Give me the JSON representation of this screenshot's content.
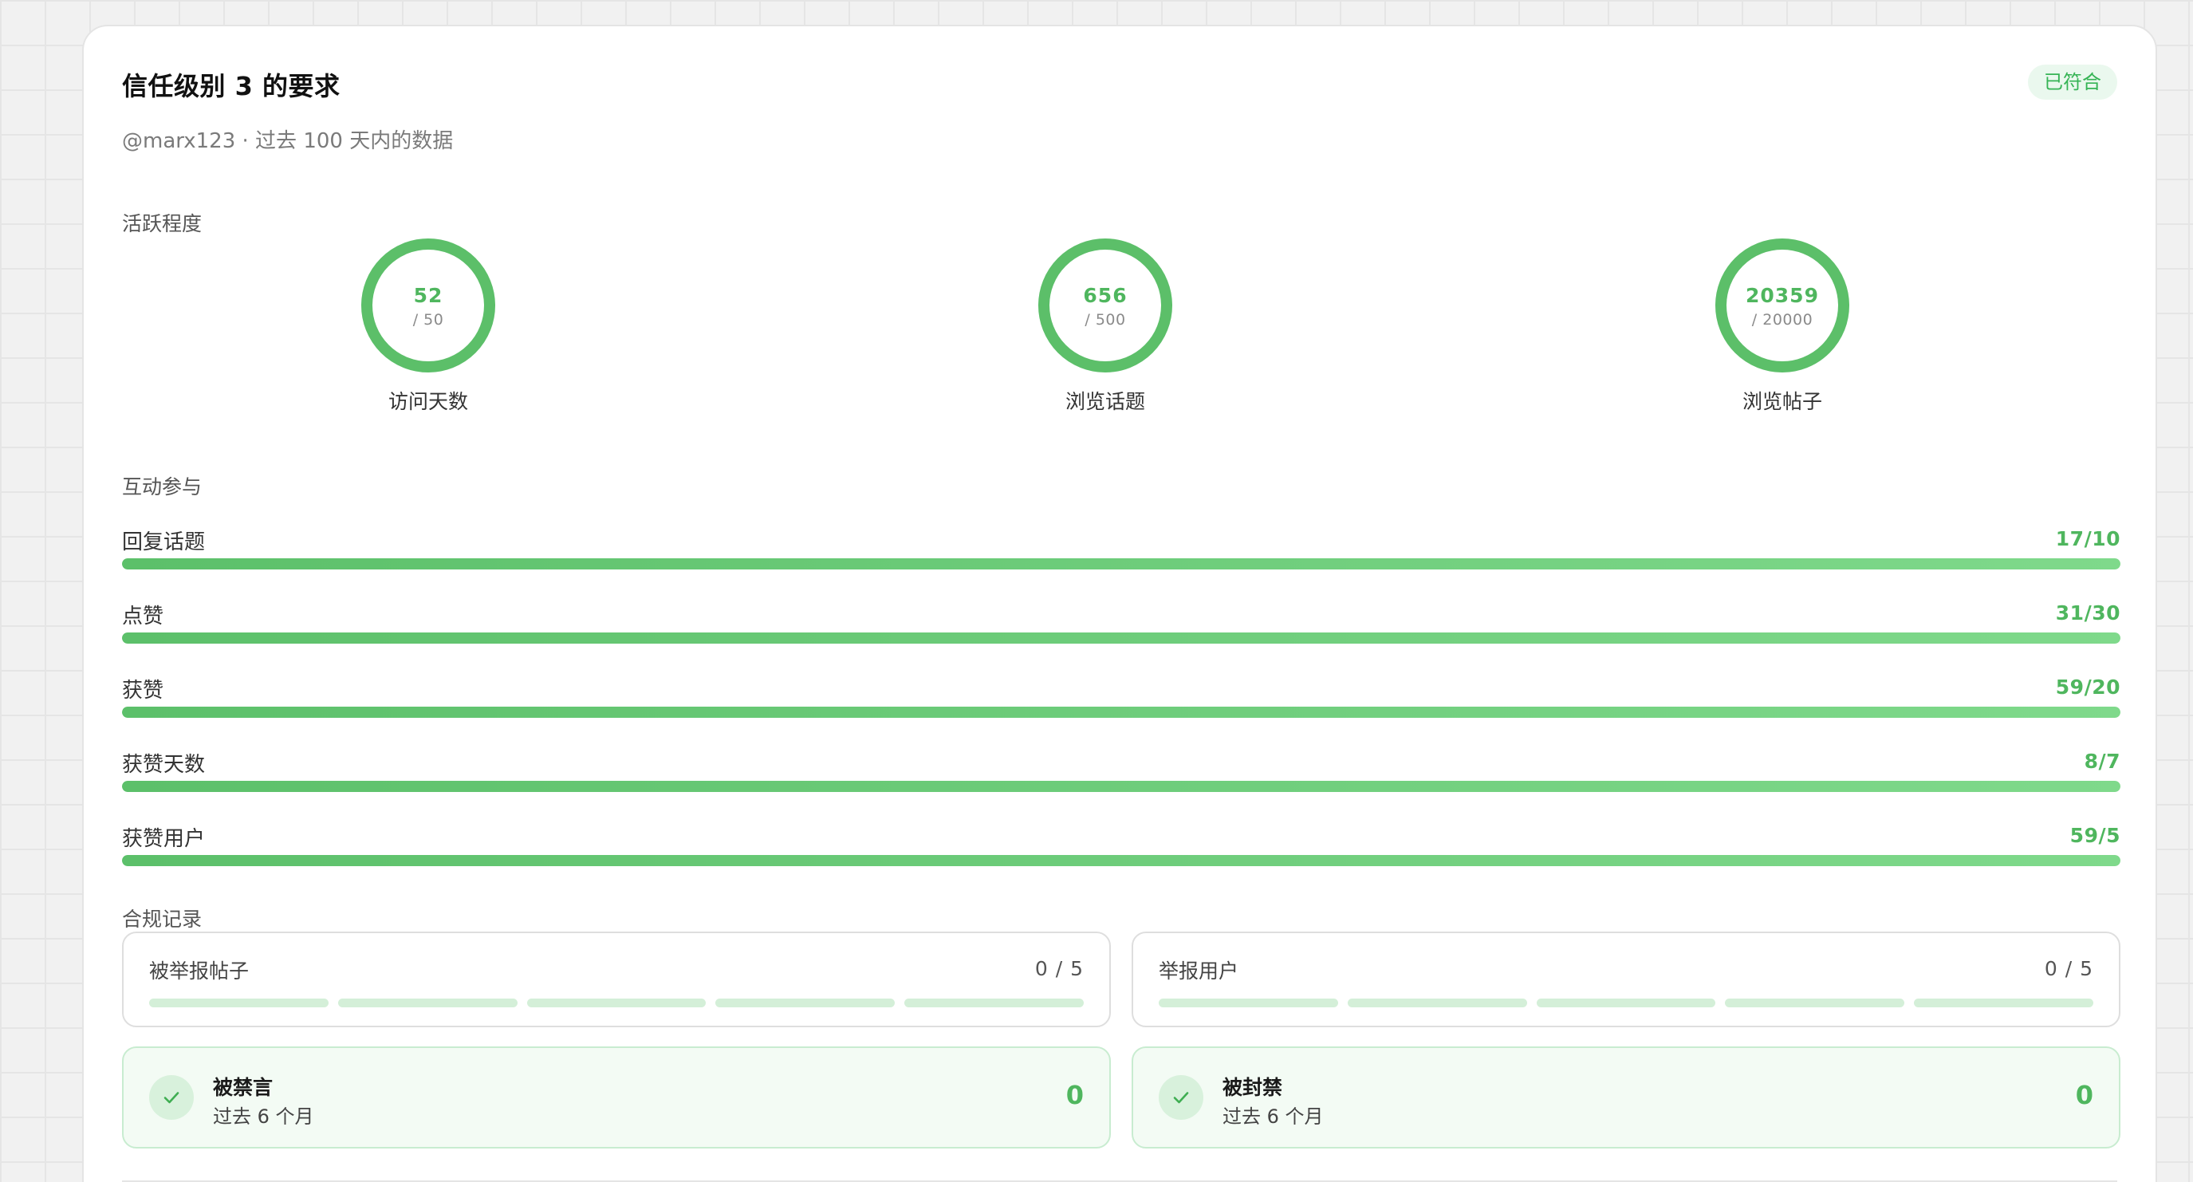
{
  "header": {
    "title": "信任级别 3 的要求",
    "badge": "已符合",
    "subtitle": "@marx123 · 过去 100 天内的数据"
  },
  "activity": {
    "label": "活跃程度",
    "rings": [
      {
        "value": "52",
        "target": "/ 50",
        "label": "访问天数",
        "progress": 1.0
      },
      {
        "value": "656",
        "target": "/ 500",
        "label": "浏览话题",
        "progress": 1.0
      },
      {
        "value": "20359",
        "target": "/ 20000",
        "label": "浏览帖子",
        "progress": 1.0
      }
    ]
  },
  "engagement": {
    "label": "互动参与",
    "bars": [
      {
        "label": "回复话题",
        "value": "17/10",
        "progress": 1.0
      },
      {
        "label": "点赞",
        "value": "31/30",
        "progress": 1.0
      },
      {
        "label": "获赞",
        "value": "59/20",
        "progress": 1.0
      },
      {
        "label": "获赞天数",
        "value": "8/7",
        "progress": 1.0
      },
      {
        "label": "获赞用户",
        "value": "59/5",
        "progress": 1.0
      }
    ]
  },
  "compliance": {
    "label": "合规记录",
    "counters": [
      {
        "label": "被举报帖子",
        "value": "0 / 5",
        "filled": 0,
        "total": 5
      },
      {
        "label": "举报用户",
        "value": "0 / 5",
        "filled": 0,
        "total": 5
      }
    ],
    "statuses": [
      {
        "title": "被禁言",
        "subtitle": "过去 6 个月",
        "value": "0"
      },
      {
        "title": "被封禁",
        "subtitle": "过去 6 个月",
        "value": "0"
      }
    ]
  },
  "colors": {
    "accent": "#4fb65e",
    "accent_light": "#d4efd8",
    "badge_bg": "#eaf8ee",
    "status_bg": "#f3fbf4"
  },
  "icons": {
    "status": "check-icon"
  }
}
